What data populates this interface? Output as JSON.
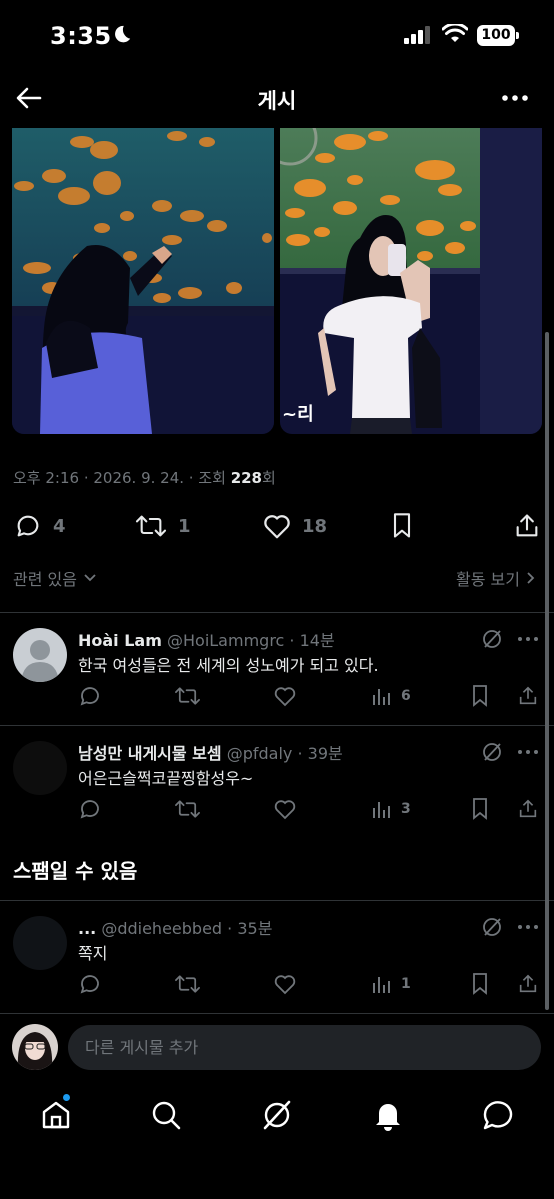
{
  "status_bar": {
    "time": "3:35",
    "battery": "100"
  },
  "header": {
    "title": "게시"
  },
  "post": {
    "meta_prefix": "오후 2:16 · 2026. 9. 24. · 조회 ",
    "views": "228",
    "views_suffix": "회",
    "photo_right_caption": "~리",
    "stats": {
      "replies": "4",
      "reposts": "1",
      "likes": "18"
    }
  },
  "related": {
    "label": "관련 있음",
    "activity_label": "활동 보기"
  },
  "replies": [
    {
      "name": "Hoài Lam",
      "handle": "@HoiLammgrc · 14분",
      "text": "한국 여성들은 전 세계의 성노예가 되고 있다.",
      "views": "6"
    },
    {
      "name": "남성만 내게시물 보셈",
      "handle": "@pfdaly · 39분",
      "text": "어은근슬쩍코끝찡함성우~",
      "views": "3"
    }
  ],
  "spam": {
    "label": "스팸일 수 있음",
    "reply": {
      "name": "...",
      "handle": "@ddieheebbed · 35분",
      "text": "쪽지",
      "views": "1"
    }
  },
  "compose": {
    "placeholder": "다른 게시물 추가"
  },
  "colors": {
    "accent": "#1d9bf0",
    "muted": "#71767b",
    "text": "#e7e9ea",
    "divider": "#2f3336"
  }
}
